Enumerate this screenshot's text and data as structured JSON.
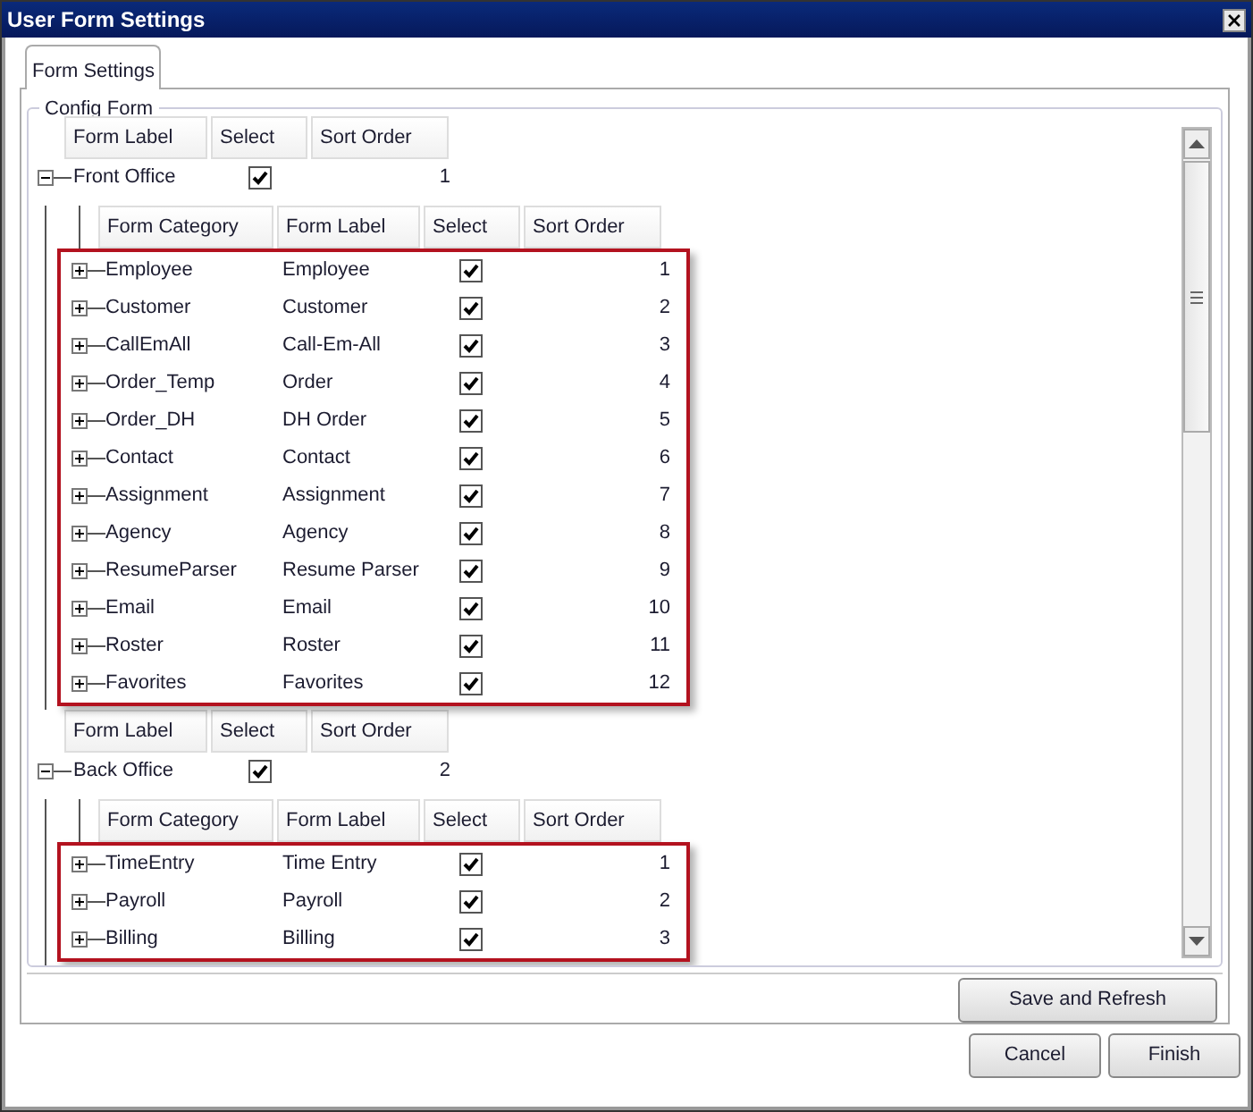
{
  "window": {
    "title": "User Form Settings"
  },
  "tabs": [
    {
      "label": "Form Settings",
      "selected": true
    }
  ],
  "group_box": {
    "title": "Config Form"
  },
  "groups": [
    {
      "header": [
        "Form Label",
        "Select",
        "Sort Order"
      ],
      "label": "Front Office",
      "expanded": true,
      "checked": true,
      "sort_order": "1",
      "highlighted": true,
      "columns": [
        "Form Category",
        "Form Label",
        "Select",
        "Sort Order"
      ],
      "rows": [
        {
          "category": "Employee",
          "label": "Employee",
          "checked": true,
          "sort_order": "1",
          "expanded": false
        },
        {
          "category": "Customer",
          "label": "Customer",
          "checked": true,
          "sort_order": "2",
          "expanded": false
        },
        {
          "category": "CallEmAll",
          "label": "Call-Em-All",
          "checked": true,
          "sort_order": "3",
          "expanded": false
        },
        {
          "category": "Order_Temp",
          "label": "Order",
          "checked": true,
          "sort_order": "4",
          "expanded": false
        },
        {
          "category": "Order_DH",
          "label": "DH Order",
          "checked": true,
          "sort_order": "5",
          "expanded": false
        },
        {
          "category": "Contact",
          "label": "Contact",
          "checked": true,
          "sort_order": "6",
          "expanded": false
        },
        {
          "category": "Assignment",
          "label": "Assignment",
          "checked": true,
          "sort_order": "7",
          "expanded": false
        },
        {
          "category": "Agency",
          "label": "Agency",
          "checked": true,
          "sort_order": "8",
          "expanded": false
        },
        {
          "category": "ResumeParser",
          "label": "Resume Parser",
          "checked": true,
          "sort_order": "9",
          "expanded": false
        },
        {
          "category": "Email",
          "label": "Email",
          "checked": true,
          "sort_order": "10",
          "expanded": false
        },
        {
          "category": "Roster",
          "label": "Roster",
          "checked": true,
          "sort_order": "11",
          "expanded": false
        },
        {
          "category": "Favorites",
          "label": "Favorites",
          "checked": true,
          "sort_order": "12",
          "expanded": false
        }
      ]
    },
    {
      "header": [
        "Form Label",
        "Select",
        "Sort Order"
      ],
      "label": "Back Office",
      "expanded": true,
      "checked": true,
      "sort_order": "2",
      "highlighted": true,
      "columns": [
        "Form Category",
        "Form Label",
        "Select",
        "Sort Order"
      ],
      "rows": [
        {
          "category": "TimeEntry",
          "label": "Time Entry",
          "checked": true,
          "sort_order": "1",
          "expanded": false
        },
        {
          "category": "Payroll",
          "label": "Payroll",
          "checked": true,
          "sort_order": "2",
          "expanded": false
        },
        {
          "category": "Billing",
          "label": "Billing",
          "checked": true,
          "sort_order": "3",
          "expanded": false
        }
      ]
    }
  ],
  "save_button": "Save and Refresh",
  "footer_buttons": [
    "Cancel",
    "Finish"
  ]
}
